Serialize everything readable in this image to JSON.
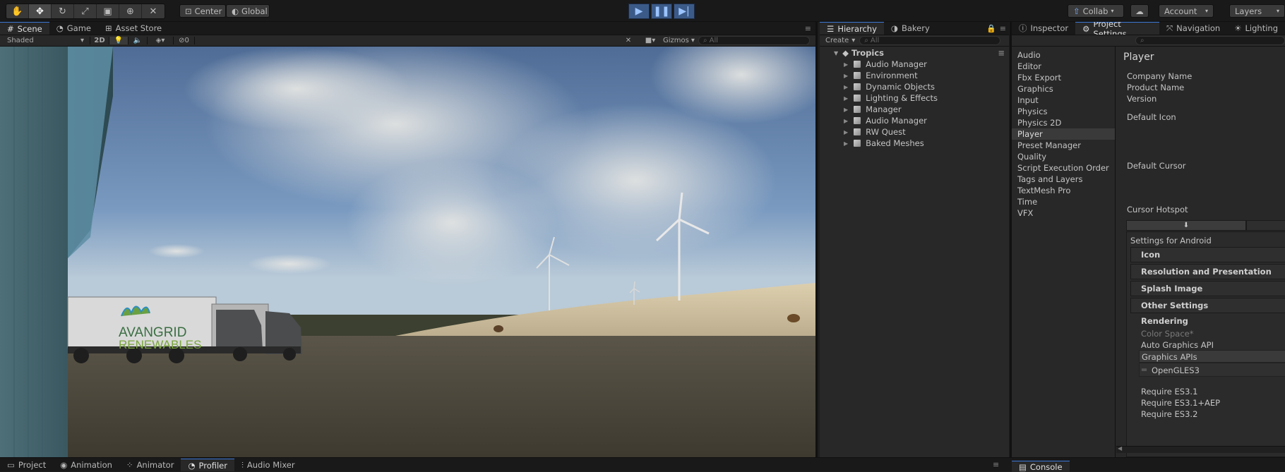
{
  "toolbar": {
    "pivot_label": "Center",
    "space_label": "Global",
    "collab_label": "Collab",
    "account_label": "Account",
    "layers_label": "Layers"
  },
  "scene_panel": {
    "tabs": [
      "Scene",
      "Game",
      "Asset Store"
    ],
    "shading_mode": "Shaded",
    "twod_label": "2D",
    "hidden_count": "0",
    "gizmos_label": "Gizmos",
    "search_placeholder": "All",
    "truck_logo_line1": "AVANGRID",
    "truck_logo_line2": "RENEWABLES"
  },
  "hierarchy_panel": {
    "tabs": [
      "Hierarchy",
      "Bakery"
    ],
    "create_label": "Create",
    "search_placeholder": "All",
    "scene_name": "Tropics",
    "items": [
      "Audio Manager",
      "Environment",
      "Dynamic Objects",
      "Lighting & Effects",
      "Manager",
      "Audio Manager",
      "RW Quest",
      "Baked Meshes"
    ]
  },
  "inspector_panel": {
    "tabs": [
      "Inspector",
      "Project Settings",
      "Navigation",
      "Lighting"
    ],
    "settings_items": [
      "Audio",
      "Editor",
      "Fbx Export",
      "Graphics",
      "Input",
      "Physics",
      "Physics 2D",
      "Player",
      "Preset Manager",
      "Quality",
      "Script Execution Order",
      "Tags and Layers",
      "TextMesh Pro",
      "Time",
      "VFX"
    ],
    "selected_item": "Player",
    "player": {
      "title": "Player",
      "company_name_label": "Company Name",
      "product_name_label": "Product Name",
      "version_label": "Version",
      "default_icon_label": "Default Icon",
      "default_cursor_label": "Default Cursor",
      "cursor_hotspot_label": "Cursor Hotspot",
      "settings_for_label": "Settings for Android",
      "sections": [
        "Icon",
        "Resolution and Presentation",
        "Splash Image",
        "Other Settings"
      ],
      "rendering_label": "Rendering",
      "color_space_label": "Color Space*",
      "auto_graphics_label": "Auto Graphics API",
      "graphics_apis_label": "Graphics APIs",
      "opengl_label": "OpenGLES3",
      "require_es31_label": "Require ES3.1",
      "require_es31aep_label": "Require ES3.1+AEP",
      "require_es32_label": "Require ES3.2"
    }
  },
  "bottom_bar": {
    "tabs": [
      "Project",
      "Animation",
      "Animator",
      "Profiler",
      "Audio Mixer"
    ],
    "selected_tab": "Profiler",
    "console_label": "Console"
  }
}
